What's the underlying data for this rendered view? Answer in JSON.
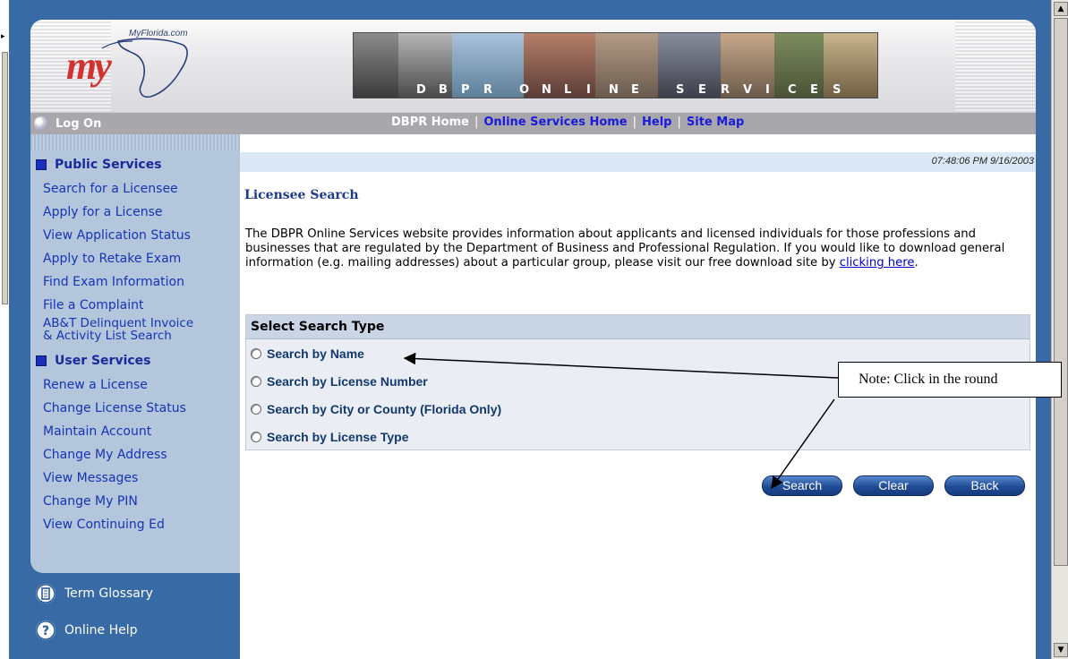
{
  "header": {
    "site_label": "MyFlorida.com",
    "logo_text": "my",
    "banner_text": [
      "D",
      "B",
      "P",
      "R",
      "O",
      "N",
      "L",
      "I",
      "N",
      "E",
      "S",
      "E",
      "R",
      "V",
      "I",
      "C",
      "E",
      "S"
    ]
  },
  "nav": {
    "logon_label": "Log On",
    "links": [
      {
        "label": "DBPR Home",
        "color": "white"
      },
      {
        "label": "Online Services Home",
        "color": "blue"
      },
      {
        "label": "Help",
        "color": "blue"
      },
      {
        "label": "Site Map",
        "color": "blue"
      }
    ],
    "separator": "|"
  },
  "sidebar": {
    "public_heading": "Public Services",
    "public_items": [
      "Search for a Licensee",
      "Apply for a License",
      "View Application Status",
      "Apply to Retake Exam",
      "Find Exam Information",
      "File a Complaint",
      "AB&T Delinquent Invoice",
      "& Activity List Search"
    ],
    "user_heading": "User Services",
    "user_items": [
      "Renew a License",
      "Change License Status",
      "Maintain Account",
      "Change My Address",
      "View Messages",
      "Change My PIN",
      "View Continuing Ed"
    ],
    "help_items": [
      {
        "label": "Term Glossary",
        "icon": "glossary-icon"
      },
      {
        "label": "Online Help",
        "icon": "question-icon"
      }
    ]
  },
  "main": {
    "timestamp": "07:48:06 PM 9/16/2003",
    "title": "Licensee Search",
    "intro_text": "The DBPR Online Services website provides information about applicants and licensed individuals for those professions and businesses that are regulated by the Department of Business and Professional Regulation. If you would like to download general information (e.g. mailing addresses) about a particular group, please visit our free download site by ",
    "intro_link": "clicking here",
    "intro_end": ".",
    "search": {
      "heading": "Select Search Type",
      "options": [
        "Search by Name",
        "Search by License Number",
        "Search by City or County (Florida Only)",
        "Search by License Type"
      ],
      "selected_index": null
    },
    "buttons": {
      "search": "Search",
      "clear": "Clear",
      "back": "Back"
    }
  },
  "annotation": {
    "note": "Note:  Click in the round"
  },
  "colors": {
    "frame_blue": "#386aa6",
    "sidebar_bg": "#b3c6dc",
    "link_blue": "#1734b4",
    "button_blue": "#1f4c96",
    "logo_red": "#d1312f"
  }
}
